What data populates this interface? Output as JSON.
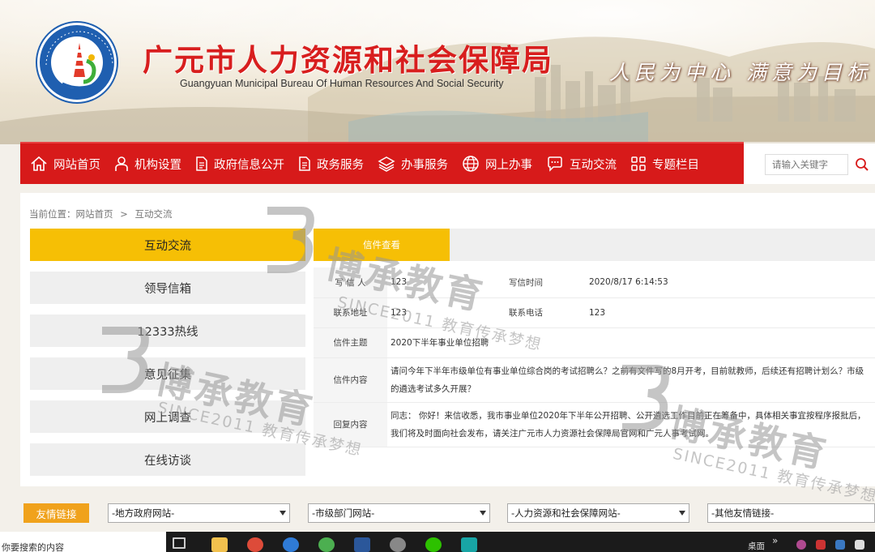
{
  "header": {
    "title": "广元市人力资源和社会保障局",
    "subtitle": "Guangyuan Municipal Bureau Of Human Resources And Social Security",
    "slogan": "人民为中心   满意为目标",
    "logo_ring_text": "GUANGYUAN RENLI ZIYUAN SHEHUI BAOZHANG"
  },
  "nav": {
    "items": [
      {
        "label": "网站首页",
        "icon": "home-icon"
      },
      {
        "label": "机构设置",
        "icon": "person-icon"
      },
      {
        "label": "政府信息公开",
        "icon": "document-icon"
      },
      {
        "label": "政务服务",
        "icon": "document-icon"
      },
      {
        "label": "办事服务",
        "icon": "layers-icon"
      },
      {
        "label": "网上办事",
        "icon": "globe-icon"
      },
      {
        "label": "互动交流",
        "icon": "chat-icon"
      },
      {
        "label": "专题栏目",
        "icon": "grid-icon"
      }
    ],
    "search_placeholder": "请输入关键字"
  },
  "breadcrumb": {
    "prefix": "当前位置：",
    "home": "网站首页",
    "separator": ">",
    "current": "互动交流"
  },
  "sidebar": {
    "items": [
      {
        "label": "互动交流",
        "active": true
      },
      {
        "label": "领导信箱",
        "active": false
      },
      {
        "label": "12333热线",
        "active": false
      },
      {
        "label": "意见征集",
        "active": false
      },
      {
        "label": "网上调查",
        "active": false
      },
      {
        "label": "在线访谈",
        "active": false
      }
    ]
  },
  "letter": {
    "tab_label": "信件查看",
    "writer_label": "写 信 人",
    "writer": "123",
    "time_label": "写信时间",
    "time": "2020/8/17 6:14:53",
    "address_label": "联系地址",
    "address": "123",
    "phone_label": "联系电话",
    "phone": "123",
    "subject_label": "信件主题",
    "subject": "2020下半年事业单位招聘",
    "content_label": "信件内容",
    "content_line1": "请问今年下半年市级单位有事业单位综合岗的考试招聘么？之前有文件写的8月开考，目前就教师，后续还有招聘计划么？市级",
    "content_line2": "的遴选考试多久开展？",
    "reply_label": "回复内容",
    "reply_line1": "同志：  你好！来信收悉，我市事业单位2020年下半年公开招聘、公开遴选工作目前正在筹备中，具体相关事宜按程序报批后，",
    "reply_line2": "我们将及时面向社会发布，请关注广元市人力资源社会保障局官网和广元人事考试网。"
  },
  "links": {
    "label": "友情链接",
    "selects": [
      "-地方政府网站-",
      "-市级部门网站-",
      "-人力资源和社会保障网站-",
      "-其他友情链接-"
    ]
  },
  "bottom": {
    "search_hint": "你要搜索的内容",
    "desktop_label": "桌面",
    "chevron": "»"
  },
  "watermark": {
    "brand": "博承教育",
    "tagline": "SINCE2011 教育传承梦想"
  },
  "colors": {
    "nav_red": "#d71a1a",
    "title_red": "#d81e1e",
    "active_yellow": "#f6bf05",
    "links_orange": "#f0a21c",
    "logo_blue": "#1f5fb0"
  }
}
